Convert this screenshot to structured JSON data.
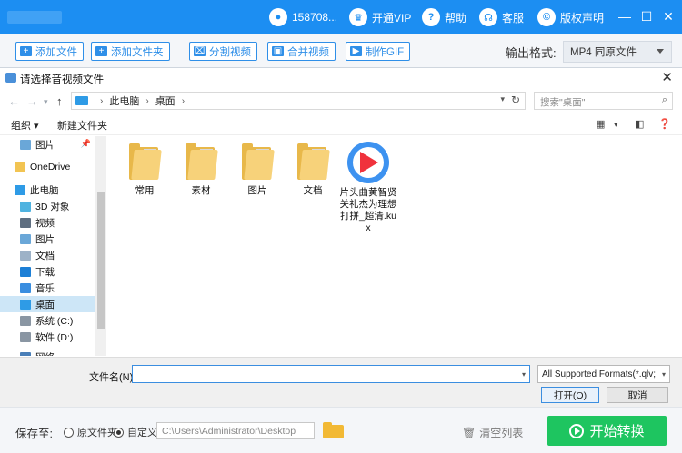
{
  "app": {
    "topbar": {
      "user": "158708...",
      "vip": "开通VIP",
      "help": "帮助",
      "support": "客服",
      "copyright": "版权声明"
    },
    "toolbar": {
      "add_file": "添加文件",
      "add_folder": "添加文件夹",
      "split_video": "分割视频",
      "merge_video": "合并视频",
      "make_gif": "制作GIF"
    },
    "output_format": {
      "label": "输出格式:",
      "value": "MP4  同原文件"
    },
    "footer": {
      "save_to_label": "保存至:",
      "radio_original": "原文件夹",
      "radio_custom": "自定义",
      "path": "C:\\Users\\Administrator\\Desktop",
      "clear_list": "清空列表",
      "start": "开始转换"
    }
  },
  "dialog": {
    "title": "请选择音视频文件",
    "breadcrumb": [
      "此电脑",
      "桌面"
    ],
    "search_placeholder": "搜索\"桌面\"",
    "commands": {
      "organize": "组织 ▾",
      "new_folder": "新建文件夹"
    },
    "nav_items": [
      {
        "label": "图片",
        "icon": "pictures-icon"
      },
      {
        "label": "OneDrive",
        "icon": "onedrive-folder-icon"
      },
      {
        "label": "此电脑",
        "icon": "this-pc-icon"
      },
      {
        "label": "3D 对象",
        "icon": "3d-objects-icon"
      },
      {
        "label": "视频",
        "icon": "videos-icon"
      },
      {
        "label": "图片",
        "icon": "pictures-icon"
      },
      {
        "label": "文档",
        "icon": "documents-icon"
      },
      {
        "label": "下载",
        "icon": "downloads-icon"
      },
      {
        "label": "音乐",
        "icon": "music-icon"
      },
      {
        "label": "桌面",
        "icon": "desktop-icon"
      },
      {
        "label": "系统 (C:)",
        "icon": "drive-c-icon"
      },
      {
        "label": "软件 (D:)",
        "icon": "drive-d-icon"
      },
      {
        "label": "网络",
        "icon": "network-icon"
      }
    ],
    "files": [
      {
        "name": "常用",
        "type": "folder"
      },
      {
        "name": "素材",
        "type": "folder"
      },
      {
        "name": "图片",
        "type": "folder"
      },
      {
        "name": "文档",
        "type": "folder"
      },
      {
        "name": "片头曲黄智贤关礼杰为理想打拼_超清.kux",
        "type": "video"
      }
    ],
    "filename_label": "文件名(N):",
    "filename_value": "",
    "filetype": "All Supported Formats(*.qlv;",
    "open_button": "打开(O)",
    "cancel_button": "取消"
  },
  "colors": {
    "titlebar": "#1c8ef2",
    "accent": "#2f8fe8",
    "start_button": "#1ec560",
    "folder": "#f2b935"
  }
}
